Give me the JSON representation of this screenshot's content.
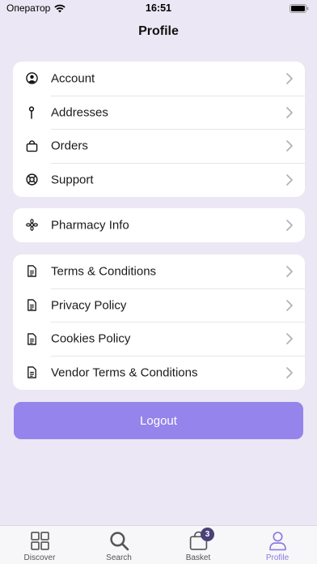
{
  "status_bar": {
    "carrier": "Оператор",
    "time": "16:51"
  },
  "header": {
    "title": "Profile"
  },
  "account_section": {
    "items": [
      {
        "label": "Account",
        "icon": "user-circle-icon"
      },
      {
        "label": "Addresses",
        "icon": "pin-icon"
      },
      {
        "label": "Orders",
        "icon": "shopping-bag-icon"
      },
      {
        "label": "Support",
        "icon": "lifebuoy-icon"
      }
    ]
  },
  "info_section": {
    "items": [
      {
        "label": "Pharmacy Info",
        "icon": "gear-flower-icon"
      }
    ]
  },
  "legal_section": {
    "items": [
      {
        "label": "Terms & Conditions",
        "icon": "document-icon"
      },
      {
        "label": "Privacy Policy",
        "icon": "document-icon"
      },
      {
        "label": "Cookies Policy",
        "icon": "document-icon"
      },
      {
        "label": "Vendor Terms & Conditions",
        "icon": "document-icon"
      }
    ]
  },
  "logout": {
    "label": "Logout"
  },
  "tabbar": {
    "tabs": [
      {
        "label": "Discover",
        "icon": "grid-icon",
        "active": false
      },
      {
        "label": "Search",
        "icon": "search-icon",
        "active": false
      },
      {
        "label": "Basket",
        "icon": "basket-icon",
        "active": false,
        "badge": "3"
      },
      {
        "label": "Profile",
        "icon": "person-icon",
        "active": true
      }
    ]
  },
  "colors": {
    "background": "#ECE7F4",
    "accent": "#9584EB",
    "active_tab": "#8C7BE0",
    "badge": "#4A4178"
  }
}
